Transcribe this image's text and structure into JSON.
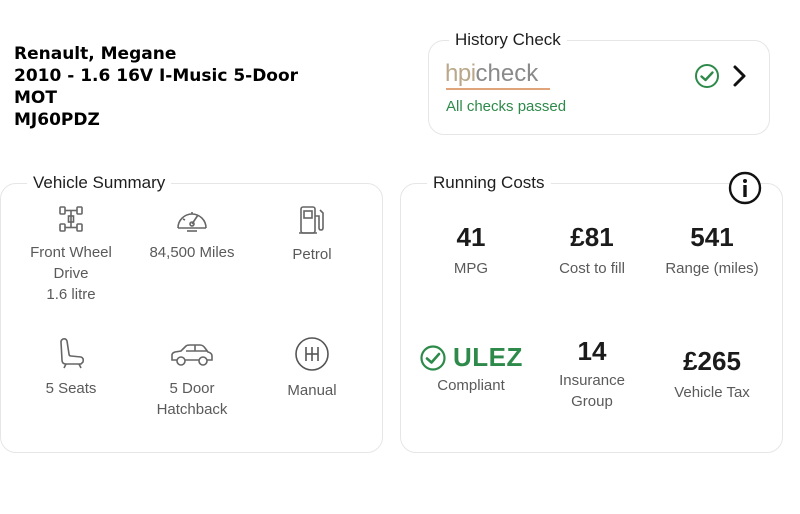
{
  "vehicle": {
    "make_model": "Renault, Megane",
    "variant": "2010 - 1.6 16V I-Music 5-Door",
    "mot": "MOT",
    "registration": "MJ60PDZ"
  },
  "history": {
    "title": "History Check",
    "logo_hpi": "hpi",
    "logo_check": "check",
    "status": "All checks passed",
    "status_icon": "check-circle-icon",
    "chevron_icon": "chevron-right-icon"
  },
  "summary": {
    "title": "Vehicle Summary",
    "specs": [
      {
        "icon": "drivetrain-icon",
        "lines": [
          "Front Wheel",
          "Drive",
          "1.6 litre"
        ]
      },
      {
        "icon": "speedometer-icon",
        "lines": [
          "84,500 Miles"
        ]
      },
      {
        "icon": "fuel-pump-icon",
        "lines": [
          "Petrol"
        ]
      },
      {
        "icon": "seat-icon",
        "lines": [
          "5 Seats"
        ]
      },
      {
        "icon": "car-icon",
        "lines": [
          "5 Door",
          "Hatchback"
        ]
      },
      {
        "icon": "gearbox-icon",
        "lines": [
          "Manual"
        ]
      }
    ]
  },
  "costs": {
    "title": "Running Costs",
    "info_icon": "info-icon",
    "mpg": {
      "value": "41",
      "label": "MPG"
    },
    "fill": {
      "value": "£81",
      "label": "Cost to fill"
    },
    "range": {
      "value": "541",
      "label": "Range (miles)"
    },
    "ulez": {
      "value": "ULEZ",
      "label": "Compliant"
    },
    "insurance": {
      "value": "14",
      "label_1": "Insurance",
      "label_2": "Group"
    },
    "tax": {
      "value": "£265",
      "label": "Vehicle Tax"
    }
  },
  "colors": {
    "accent_green": "#2e8a4a",
    "hpi_brand": "#b9a88a",
    "hpi_underline": "#e0a47a"
  }
}
